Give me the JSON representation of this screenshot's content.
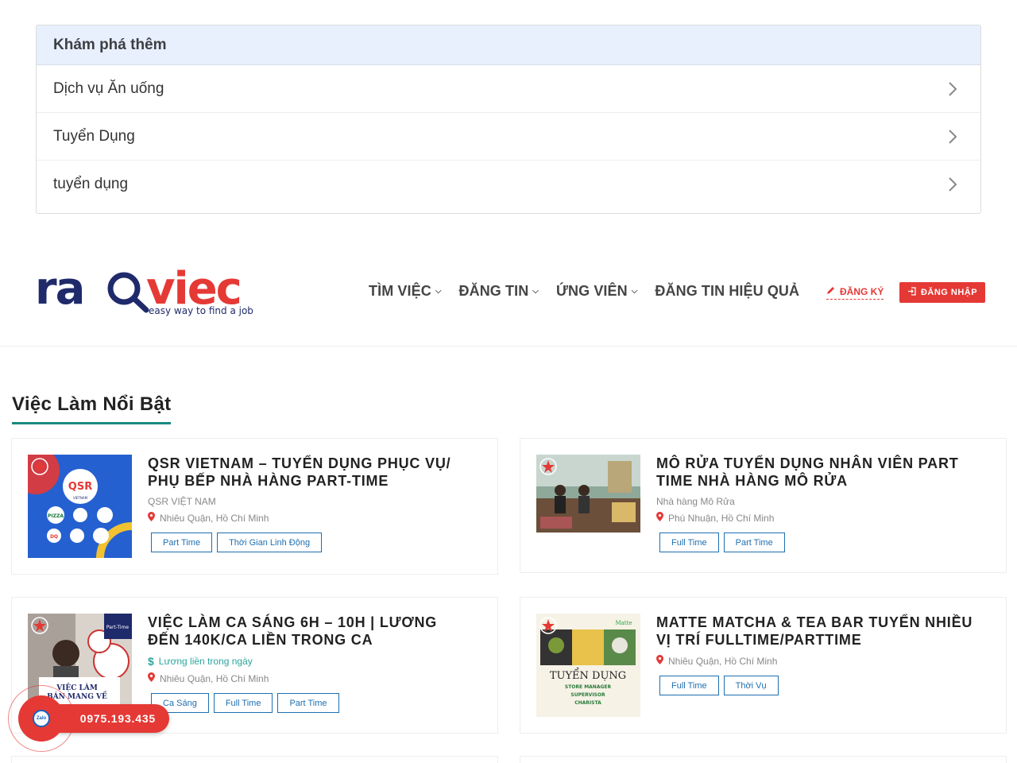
{
  "explore": {
    "title": "Khám phá thêm",
    "items": [
      {
        "label": "Dịch vụ Ăn uống"
      },
      {
        "label": "Tuyển Dụng"
      },
      {
        "label": "tuyển dụng"
      }
    ]
  },
  "header": {
    "logo_text": "raqviec",
    "logo_tagline": "easy way to find a job",
    "nav": [
      {
        "label": "TÌM VIỆC"
      },
      {
        "label": "ĐĂNG TIN"
      },
      {
        "label": "ỨNG VIÊN"
      },
      {
        "label": "ĐĂNG TIN HIỆU QUẢ"
      }
    ],
    "register_label": "ĐĂNG KÝ",
    "login_label": "ĐĂNG NHẬP"
  },
  "section": {
    "title": "Việc Làm Nổi Bật"
  },
  "jobs": [
    {
      "title": "QSR VIETNAM – TUYỂN DỤNG PHỤC VỤ/ PHỤ BẾP NHÀ HÀNG PART-TIME",
      "company": "QSR VIỆT NAM",
      "location": "Nhiêu Quận, Hồ Chí Minh",
      "tags": [
        "Part Time",
        "Thời Gian Linh Động"
      ]
    },
    {
      "title": "MÔ RỬA TUYỂN DỤNG NHÂN VIÊN PART TIME NHÀ HÀNG MÔ RỬA",
      "company": "Nhà hàng Mô Rửa",
      "location": "Phú Nhuận, Hồ Chí Minh",
      "tags": [
        "Full Time",
        "Part Time"
      ]
    },
    {
      "title": "VIỆC LÀM CA SÁNG 6h – 10h | LƯƠNG ĐẾN 140K/CA LIỀN TRONG CA",
      "salary": "Lương liền trong ngày",
      "location": "Nhiêu Quận, Hồ Chí Minh",
      "tags": [
        "Ca Sáng",
        "Full Time",
        "Part Time"
      ]
    },
    {
      "title": "MATTE MATCHA & TEA BAR TUYỂN NHIỀU VỊ TRÍ FULLTIME/PARTTIME",
      "location": "Nhiêu Quận, Hồ Chí Minh",
      "tags": [
        "Full Time",
        "Thời Vụ"
      ]
    }
  ],
  "thumbs": {
    "qsr_brand": "QSR",
    "qsr_sub": "VIETNAM",
    "pizza": "PIZZA",
    "dq": "DQ",
    "parttime_badge": "Part-Time",
    "viec_lam_1": "VIỆC LÀM",
    "viec_lam_2": "BÁN MANG VỀ",
    "matte_brand": "Matte",
    "tuyen_dung": "TUYỂN DỤNG",
    "pos1": "STORE MANAGER",
    "pos2": "SUPERVISOR",
    "pos3": "CHARISTA"
  },
  "zalo": {
    "phone": "0975.193.435",
    "icon_text": "Zalo"
  },
  "colors": {
    "accent_red": "#e53935",
    "teal": "#1a8a80",
    "navy": "#1f2a6b",
    "tag_blue": "#1e6fb0"
  }
}
